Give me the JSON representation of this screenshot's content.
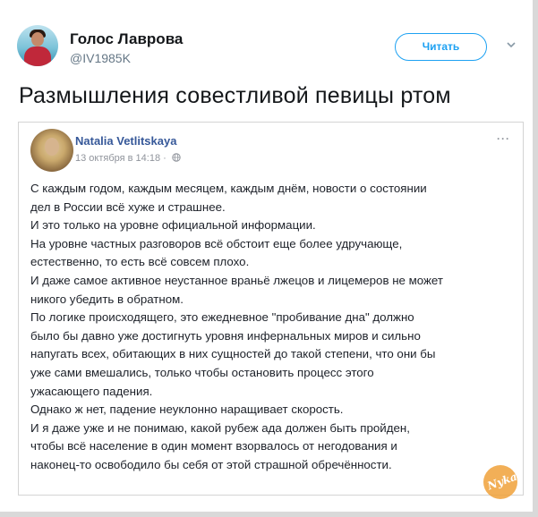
{
  "tweet": {
    "author_name": "Голос Лаврова",
    "author_handle": "@IV1985K",
    "follow_label": "Читать",
    "text": "Размышления совестливой певицы ртом"
  },
  "embedded_post": {
    "author": "Natalia Vetlitskaya",
    "date": "13 октября в 14:18 ·",
    "more_label": "···",
    "lines": [
      "С каждым годом, каждым месяцем, каждым днём, новости о состоянии",
      "дел в России всё хуже и страшнее.",
      "И это только на уровне официальной информации.",
      "На уровне частных разговоров всё обстоит еще более удручающе,",
      "естественно, то есть всё совсем плохо.",
      "И даже самое активное неустанное враньё лжецов и лицемеров не может",
      "никого убедить в обратном.",
      "По логике происходящего, это ежедневное \"пробивание дна\" должно",
      "было бы давно уже достигнуть уровня инфернальных миров и сильно",
      "напугать всех, обитающих в них сущностей до такой степени, что они бы",
      "уже сами вмешались, только чтобы остановить процесс этого",
      "ужасающего падения.",
      "Однако ж нет, падение неуклонно наращивает скорость.",
      "И я даже уже и не понимаю, какой рубеж ада должен быть пройден,",
      "чтобы всё население в один момент взорвалось от негодования и",
      "наконец-то освободило бы себя от этой страшной обречённости."
    ]
  },
  "watermark": {
    "text": "Nyka"
  },
  "colors": {
    "twitter_blue": "#1da1f2",
    "fb_link": "#365899",
    "muted": "#657786",
    "watermark": "#f0a23a"
  },
  "icons": [
    "chevron-down-icon",
    "globe-icon",
    "more-icon"
  ]
}
